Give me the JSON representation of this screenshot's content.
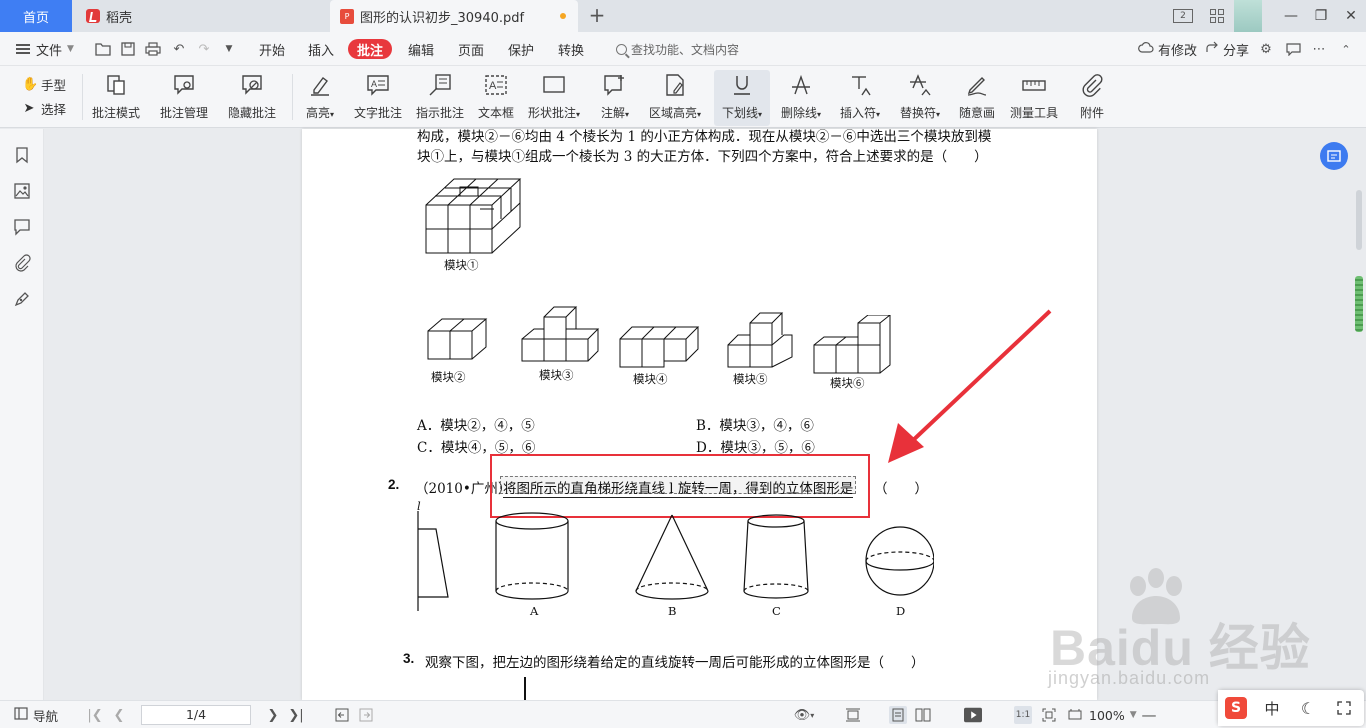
{
  "tabs": {
    "home": "首页",
    "daoke": "稻壳",
    "document": "图形的认识初步_30940.pdf"
  },
  "titlebar": {
    "badge": "2"
  },
  "menubar": {
    "file": "文件",
    "tabs": [
      "开始",
      "插入",
      "批注",
      "编辑",
      "页面",
      "保护",
      "转换"
    ],
    "active_tab": "批注",
    "search_placeholder": "查找功能、文档内容",
    "modified": "有修改",
    "share": "分享"
  },
  "ribbon": {
    "hand": "手型",
    "select": "选择",
    "tools": [
      {
        "label": "批注模式",
        "icon": "annotation-mode-icon"
      },
      {
        "label": "批注管理",
        "icon": "annotation-manage-icon"
      },
      {
        "label": "隐藏批注",
        "icon": "hide-annotation-icon"
      },
      {
        "label": "高亮",
        "icon": "highlight-icon"
      },
      {
        "label": "文字批注",
        "icon": "text-annotation-icon"
      },
      {
        "label": "指示批注",
        "icon": "pointer-annotation-icon"
      },
      {
        "label": "文本框",
        "icon": "textbox-icon"
      },
      {
        "label": "形状批注",
        "icon": "shape-annotation-icon"
      },
      {
        "label": "注解",
        "icon": "note-icon"
      },
      {
        "label": "区域高亮",
        "icon": "area-highlight-icon"
      },
      {
        "label": "下划线",
        "icon": "underline-icon"
      },
      {
        "label": "删除线",
        "icon": "strikethrough-icon"
      },
      {
        "label": "插入符",
        "icon": "insert-caret-icon"
      },
      {
        "label": "替换符",
        "icon": "replace-caret-icon"
      },
      {
        "label": "随意画",
        "icon": "freehand-icon"
      },
      {
        "label": "测量工具",
        "icon": "measure-icon"
      },
      {
        "label": "附件",
        "icon": "attachment-icon"
      }
    ]
  },
  "document": {
    "intro_line1": "构成，模块②－⑥均由 4 个棱长为 1 的小正方体构成．现在从模块②－⑥中选出三个模块放到模",
    "intro_line2": "块①上，与模块①组成一个棱长为 3 的大正方体．下列四个方案中，符合上述要求的是（　　）",
    "module1": "模块①",
    "modules": [
      "模块②",
      "模块③",
      "模块④",
      "模块⑤",
      "模块⑥"
    ],
    "options": {
      "A": "A．模块②，④，⑤",
      "B": "B．模块③，④，⑥",
      "C": "C．模块④，⑤，⑥",
      "D": "D．模块③，⑤，⑥"
    },
    "q2_num": "2.",
    "q2_source": "（2010•广州）",
    "q2_text": "将图所示的直角梯形绕直线 l 旋转一周，得到的立体图形是",
    "q2_tail": "（　　）",
    "axis_label": "l",
    "shape_labels": [
      "A",
      "B",
      "C",
      "D"
    ],
    "q3_num": "3.",
    "q3_text": "观察下图，把左边的图形绕着给定的直线旋转一周后可能形成的立体图形是（　　）"
  },
  "statusbar": {
    "nav": "导航",
    "page_indicator": "1/4",
    "zoom": "100%"
  },
  "watermark": {
    "text": "Baidu 经验",
    "url": "jingyan.baidu.com"
  },
  "ime": {
    "mode": "中"
  },
  "colors": {
    "accent": "#3f7ef3",
    "annotate_tab": "#e8383d",
    "highlight_box": "#e8313a",
    "arrow": "#e8313a"
  }
}
